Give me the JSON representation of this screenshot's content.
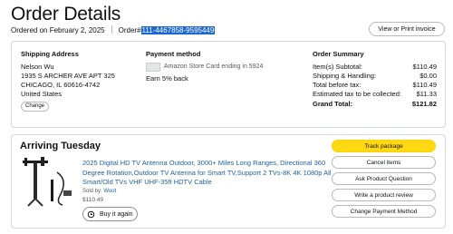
{
  "header": {
    "title": "Order Details",
    "ordered_on": "Ordered on February 2, 2025",
    "order_label": "Order#",
    "order_number": "111-4467858-9595449",
    "invoice_button": "View or Print invoice"
  },
  "shipping": {
    "title": "Shipping Address",
    "name": "Nelson Wu",
    "line1": "1935 S ARCHER AVE APT 325",
    "line2": "CHICAGO, IL 60616-4742",
    "country": "United States",
    "change_button": "Change"
  },
  "payment": {
    "title": "Payment method",
    "card_text": "Amazon Store Card  ending in 5924",
    "earn_text": "Earn 5% back"
  },
  "summary": {
    "title": "Order Summary",
    "rows": [
      {
        "label": "Item(s) Subtotal:",
        "value": "$110.49"
      },
      {
        "label": "Shipping & Handling:",
        "value": "$0.00"
      },
      {
        "label": "Total before tax:",
        "value": "$110.49"
      },
      {
        "label": "Estimated tax to be collected:",
        "value": "$11.33"
      }
    ],
    "grand_total_label": "Grand Total:",
    "grand_total_value": "$121.82"
  },
  "shipment": {
    "status": "Arriving Tuesday",
    "product_title": "2025 Digital HD TV Antenna Outdoor, 3000+ Miles Long Ranges, Directional 360 Degree Rotation,Outdoor TV Antenna for Smart TV,Support 2 TVs-8K 4K 1080p All Smart/Old TVs VHF UHF-35ft HDTV Cable",
    "sold_by_label": "Sold by:",
    "seller": "Woot",
    "price": "$110.49",
    "buy_again": "Buy it again",
    "actions": [
      "Track package",
      "Cancel items",
      "Ask Product Question",
      "Write a product review",
      "Change Payment Method"
    ]
  },
  "colors": {
    "primary_button": "#ffd814",
    "link": "#2162a1",
    "selection": "#1a66d2"
  },
  "icons": [
    "credit-card-icon",
    "buy-again-icon",
    "product-image"
  ]
}
